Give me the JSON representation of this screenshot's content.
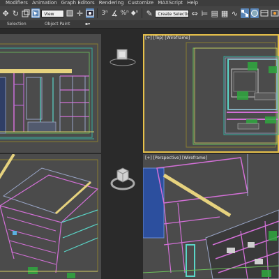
{
  "menu": [
    "Modifiers",
    "Animation",
    "Graph Editors",
    "Rendering",
    "Customize",
    "MAXScript",
    "Help"
  ],
  "toolbar": {
    "view_dropdown": "View",
    "selection_set_dropdown": "Create Selection Set"
  },
  "ribbon": {
    "selection_label": "Selection",
    "object_paint_label": "Object Paint"
  },
  "viewports": {
    "top": {
      "plus": "[+]",
      "name": "[Top]",
      "shading": "[Wireframe]"
    },
    "perspective": {
      "plus": "[+]",
      "name": "[Perspective]",
      "shading": "[Wireframe]"
    }
  },
  "colors": {
    "viewport_bg": "#4b4b4b",
    "active_border": "#e8c24a",
    "toolbar_active": "#5a86b8"
  },
  "icons": [
    "move-icon",
    "rotate-icon",
    "select-icon",
    "snap-icon",
    "render-icon"
  ]
}
